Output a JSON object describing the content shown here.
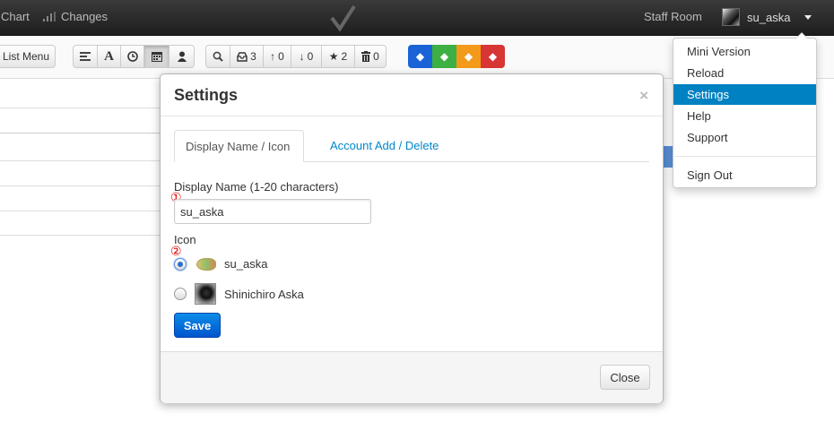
{
  "navbar": {
    "chart_label": "Chart",
    "changes_label": "Changes",
    "staff_room_label": "Staff Room",
    "username": "su_aska"
  },
  "toolbar": {
    "list_menu_label": "List Menu",
    "inbox_count": "3",
    "up_count": "0",
    "down_count": "0",
    "star_count": "2",
    "trash_count": "0",
    "tag_colors": [
      "#1a63d6",
      "#3db043",
      "#f39a1a",
      "#d83535"
    ]
  },
  "modal": {
    "title": "Settings",
    "close_symbol": "×",
    "tabs": [
      {
        "label": "Display Name / Icon"
      },
      {
        "label": "Account Add / Delete"
      }
    ],
    "display_name_label": "Display Name (1-20 characters)",
    "marker1": "①",
    "display_name_value": "su_aska",
    "icon_label": "Icon",
    "marker2": "②",
    "icon_options": [
      {
        "label": "su_aska",
        "selected": true,
        "icon": "fish-icon"
      },
      {
        "label": "Shinichiro Aska",
        "selected": false,
        "icon": "photo-icon"
      }
    ],
    "save_label": "Save",
    "close_label": "Close"
  },
  "dropdown": {
    "items": [
      {
        "label": "Mini Version"
      },
      {
        "label": "Reload"
      },
      {
        "label": "Settings"
      },
      {
        "label": "Help"
      },
      {
        "label": "Support"
      },
      {
        "label": "Sign Out"
      }
    ]
  }
}
